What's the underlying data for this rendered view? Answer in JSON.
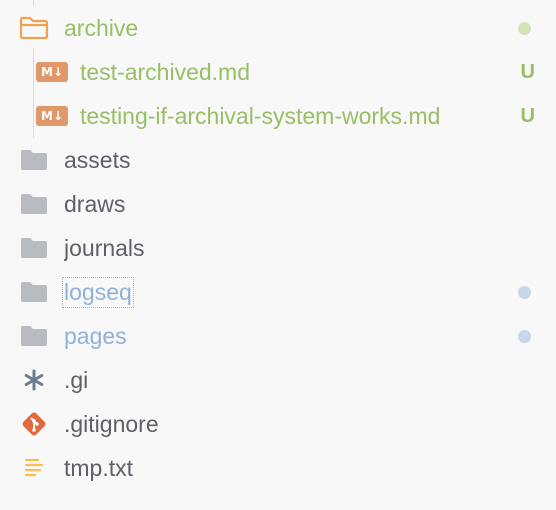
{
  "colors": {
    "background": "#f8f8f8",
    "text_default": "#5c6069",
    "text_untracked": "#98bf64",
    "text_modified": "#8fb2d8",
    "dot_untracked": "#d3e3b8",
    "dot_modified": "#c6d7ea",
    "folder_gray": "#b8bcc1",
    "folder_orange": "#f0a050",
    "md_icon": "#e0986a",
    "git_icon": "#e06a3c",
    "txt_icon": "#f7be52",
    "asterisk_icon": "#6c7d90"
  },
  "tree": {
    "items": [
      {
        "label": "archive",
        "icon": "folder-open-icon",
        "status": "dot-untracked",
        "depth": 0
      },
      {
        "label": "test-archived.md",
        "icon": "markdown-file-icon",
        "status_badge": "U",
        "depth": 1
      },
      {
        "label": "testing-if-archival-system-works.md",
        "icon": "markdown-file-icon",
        "status_badge": "U",
        "depth": 1
      },
      {
        "label": "assets",
        "icon": "folder-icon",
        "depth": 0
      },
      {
        "label": "draws",
        "icon": "folder-icon",
        "depth": 0
      },
      {
        "label": "journals",
        "icon": "folder-icon",
        "depth": 0
      },
      {
        "label": "logseq",
        "icon": "folder-icon",
        "status": "dot-modified",
        "depth": 0
      },
      {
        "label": "pages",
        "icon": "folder-icon",
        "status": "dot-modified",
        "depth": 0
      },
      {
        "label": ".gi",
        "icon": "asterisk-icon",
        "depth": 0
      },
      {
        "label": ".gitignore",
        "icon": "git-icon",
        "depth": 0
      },
      {
        "label": "tmp.txt",
        "icon": "text-file-icon",
        "depth": 0
      }
    ]
  }
}
